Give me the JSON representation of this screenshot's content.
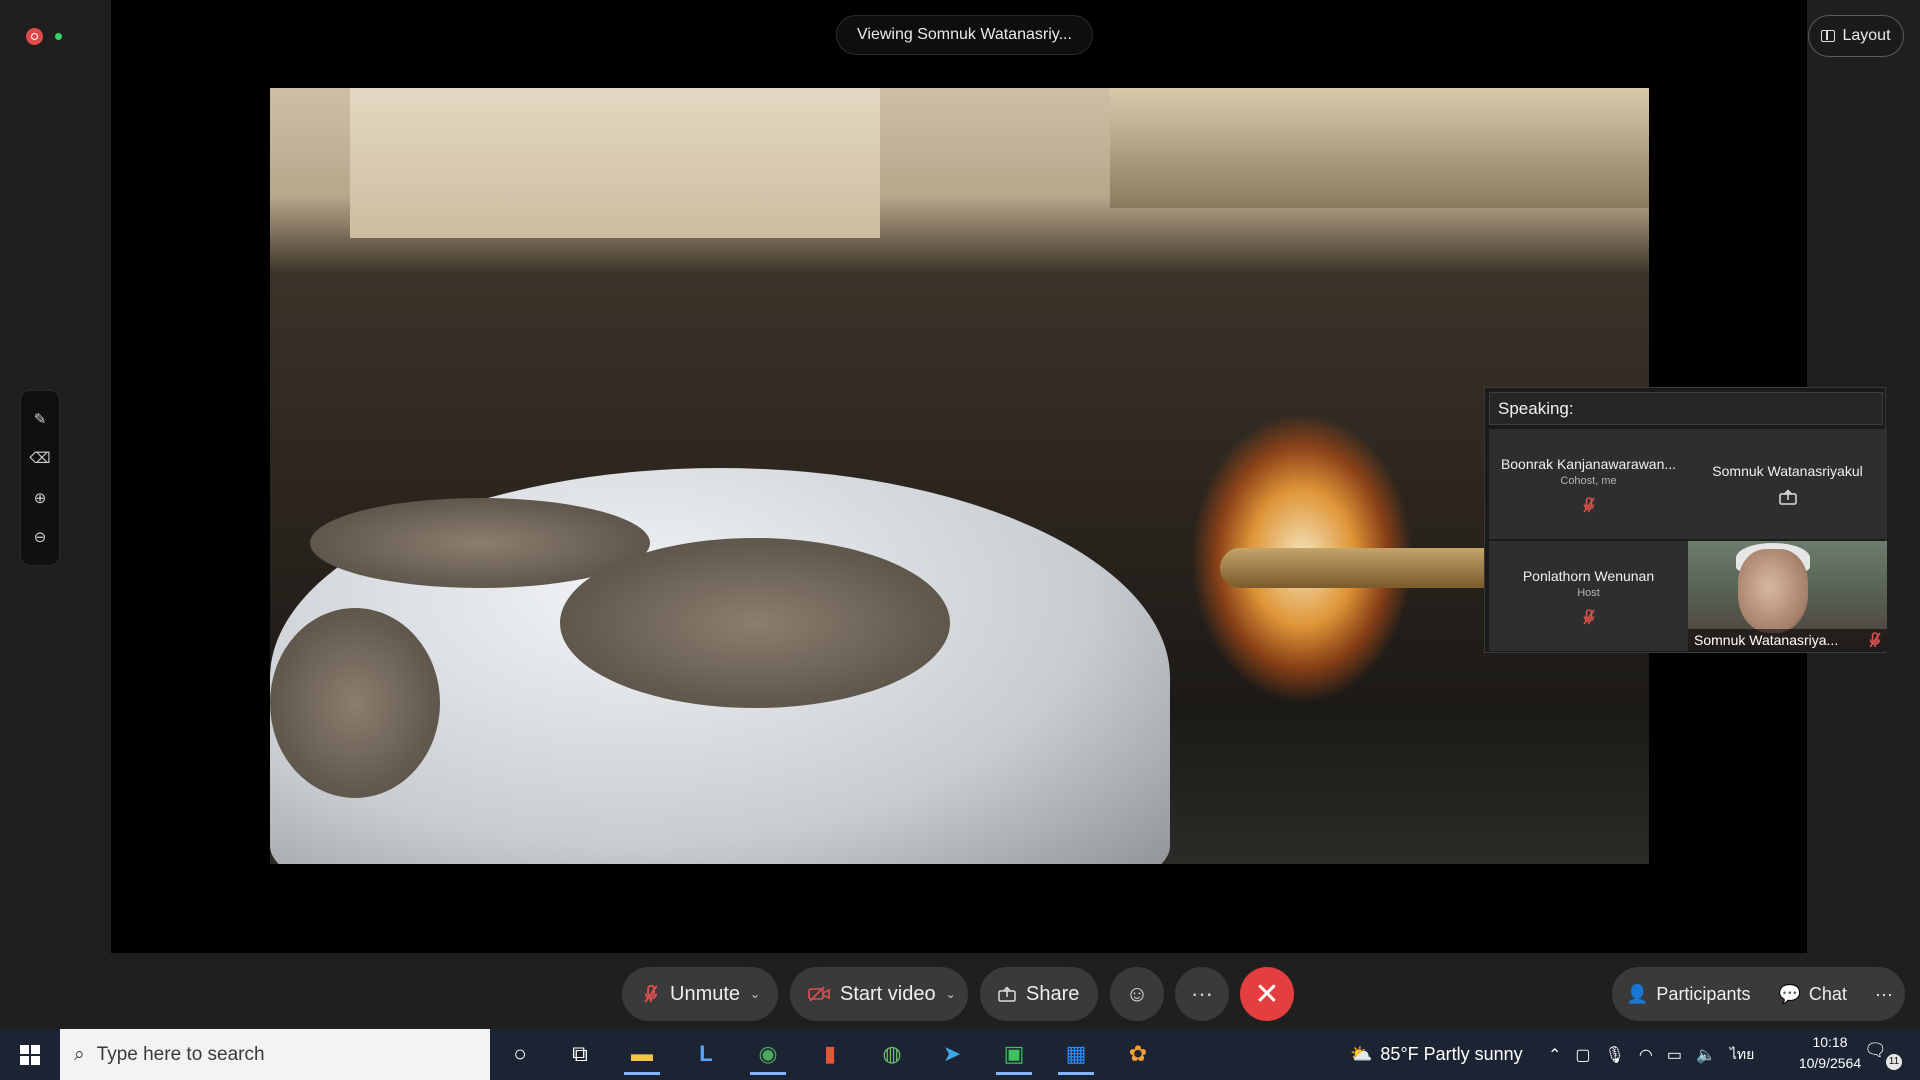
{
  "header": {
    "viewing_label": "Viewing Somnuk Watanasriy...",
    "layout_label": "Layout"
  },
  "gallery": {
    "speaking_label": "Speaking:",
    "tiles": [
      {
        "name": "Boonrak Kanjanawarawan...",
        "role": "Cohost, me",
        "mic": "muted"
      },
      {
        "name": "Somnuk Watanasriyakul",
        "role": "",
        "mic": "sharing"
      },
      {
        "name": "Ponlathorn Wenunan",
        "role": "Host",
        "mic": "muted"
      },
      {
        "name": "Somnuk Watanasriya...",
        "role": "",
        "mic": "muted",
        "video": true
      }
    ]
  },
  "toolbar": {
    "unmute_label": "Unmute",
    "start_video_label": "Start video",
    "share_label": "Share",
    "participants_label": "Participants",
    "chat_label": "Chat",
    "accent_end": "#e53e3e",
    "accent_muted": "#e05050"
  },
  "taskbar": {
    "search_placeholder": "Type here to search",
    "weather": "85°F  Partly sunny",
    "language": "ไทย",
    "time": "10:18",
    "date": "10/9/2564",
    "notifications": "11"
  }
}
